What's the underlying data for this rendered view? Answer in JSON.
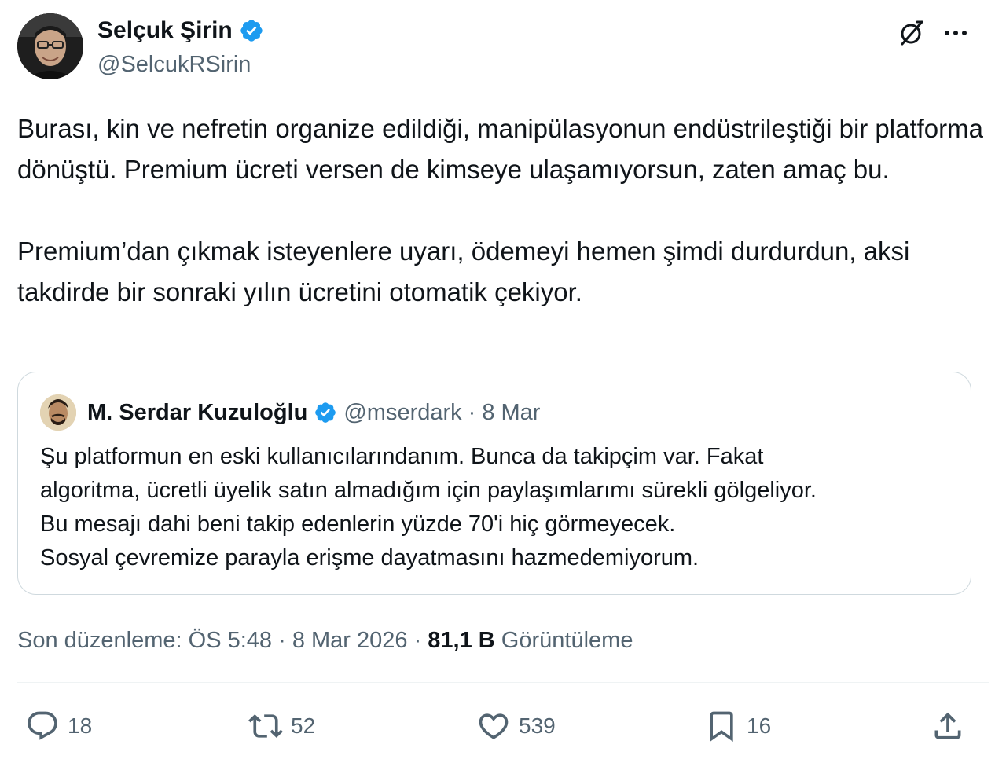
{
  "author": {
    "display_name": "Selçuk Şirin",
    "handle": "@SelcukRSirin",
    "verified": true
  },
  "top_actions": {
    "grok_icon": "grok-icon",
    "more_icon": "more-horizontal-icon"
  },
  "tweet": {
    "paragraphs": [
      "Burası, kin ve nefretin organize edildiği, manipülasyonun endüstrileştiği bir platforma dönüştü. Premium ücreti versen de kimseye ulaşamıyorsun, zaten amaç bu.",
      "Premium’dan çıkmak isteyenlere uyarı, ödemeyi hemen şimdi durdurdun, aksi takdirde bir sonraki yılın ücretini otomatik çekiyor."
    ]
  },
  "quote": {
    "display_name": "M. Serdar Kuzuloğlu",
    "handle": "@mserdark",
    "separator": "·",
    "date": "8 Mar",
    "verified": true,
    "lines": [
      "Şu platformun en eski kullanıcılarındanım. Bunca da takipçim var. Fakat",
      "algoritma, ücretli üyelik satın almadığım için paylaşımlarımı sürekli gölgeliyor.",
      "Bu mesajı dahi beni takip edenlerin yüzde 70'i hiç görmeyecek.",
      "Sosyal çevremize parayla erişme dayatmasını hazmedemiyorum."
    ]
  },
  "meta": {
    "edited_label": "Son düzenleme: ÖS 5:48 · 8 Mar 2026 · ",
    "views_count": "81,1 B",
    "views_label": " Görüntüleme"
  },
  "actions": {
    "replies": "18",
    "reposts": "52",
    "likes": "539",
    "bookmarks": "16"
  },
  "colors": {
    "verified_blue": "#1d9bf0",
    "text_primary": "#0f1419",
    "text_secondary": "#536471",
    "border": "#cfd9de"
  }
}
